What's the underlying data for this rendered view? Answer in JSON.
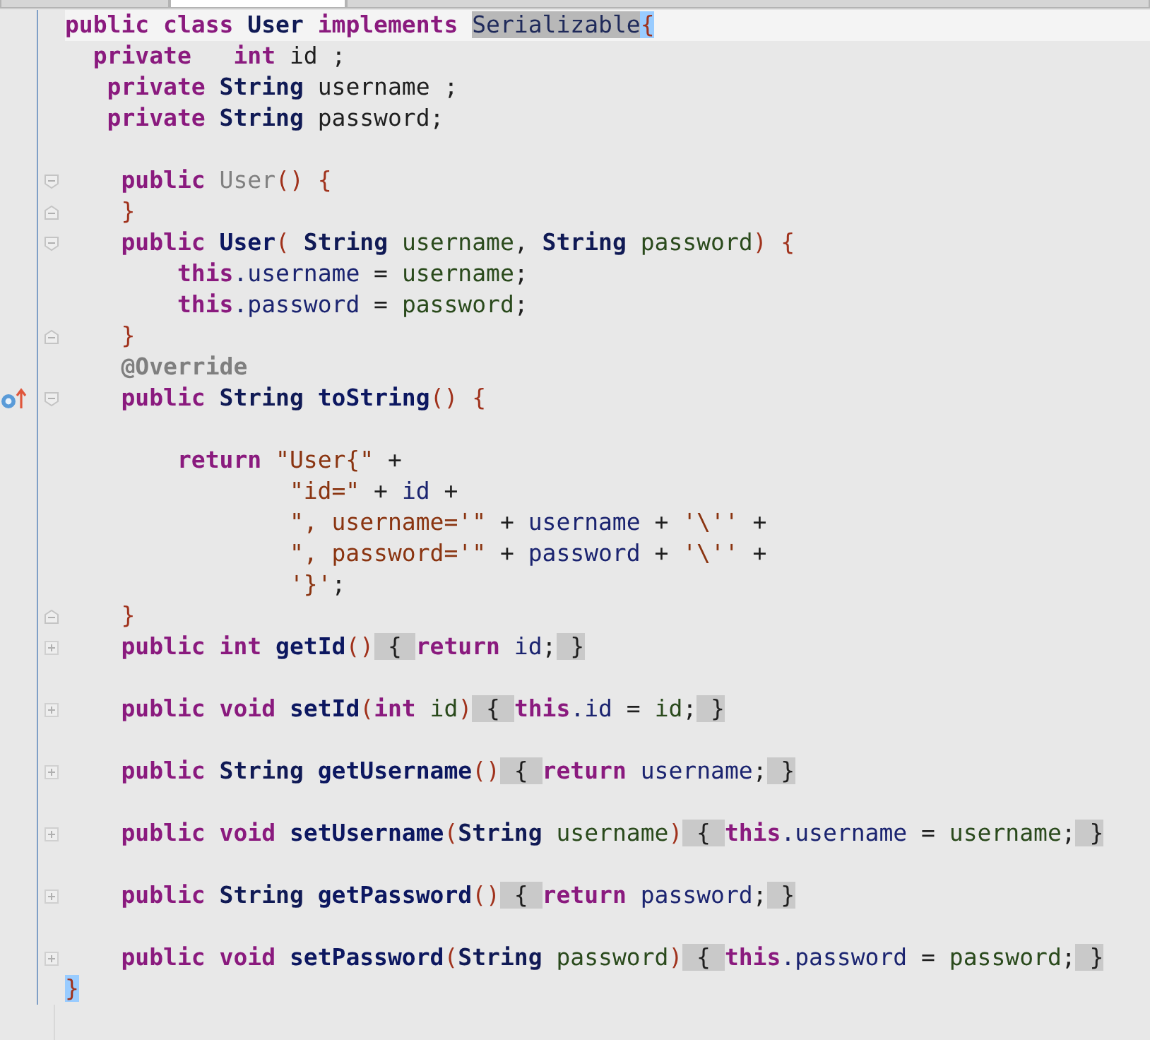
{
  "tabs": [
    {
      "selected": false
    },
    {
      "selected": true
    },
    {
      "selected": false
    }
  ],
  "lines": [
    {
      "current": true,
      "tokens": [
        {
          "kind": "kw",
          "text": "public class "
        },
        {
          "kind": "type",
          "text": "User"
        },
        {
          "kind": "kw",
          "text": " implements "
        },
        {
          "kind": "hl",
          "text": "Serializable"
        },
        {
          "kind": "match",
          "text": "{"
        }
      ]
    },
    {
      "current": false,
      "tokens": [
        {
          "kind": "kw",
          "text": "  private   int"
        },
        {
          "kind": "plain",
          "text": " id ;"
        }
      ]
    },
    {
      "current": false,
      "tokens": [
        {
          "kind": "kw",
          "text": "   private "
        },
        {
          "kind": "type",
          "text": "String"
        },
        {
          "kind": "plain",
          "text": " username ;"
        }
      ]
    },
    {
      "current": false,
      "tokens": [
        {
          "kind": "kw",
          "text": "   private "
        },
        {
          "kind": "type",
          "text": "String"
        },
        {
          "kind": "plain",
          "text": " password;"
        }
      ]
    },
    {
      "current": false
    },
    {
      "current": false,
      "fold": {
        "kind": "open"
      },
      "tokens": [
        {
          "kind": "kw",
          "text": "    public "
        },
        {
          "kind": "unused",
          "text": "User"
        },
        {
          "kind": "punc",
          "text": "() {"
        }
      ]
    },
    {
      "current": false,
      "fold": {
        "kind": "close"
      },
      "tokens": [
        {
          "kind": "punc",
          "text": "    }"
        }
      ]
    },
    {
      "current": false,
      "fold": {
        "kind": "open"
      },
      "tokens": [
        {
          "kind": "kw",
          "text": "    public "
        },
        {
          "kind": "method",
          "text": "User"
        },
        {
          "kind": "punc",
          "text": "( "
        },
        {
          "kind": "type",
          "text": "String"
        },
        {
          "kind": "param",
          "text": " username"
        },
        {
          "kind": "plain",
          "text": ", "
        },
        {
          "kind": "type",
          "text": "String"
        },
        {
          "kind": "param",
          "text": " password"
        },
        {
          "kind": "punc",
          "text": ") {"
        }
      ]
    },
    {
      "current": false,
      "tokens": [
        {
          "kind": "kw",
          "text": "        this"
        },
        {
          "kind": "field",
          "text": ".username"
        },
        {
          "kind": "plain",
          "text": " = "
        },
        {
          "kind": "param",
          "text": "username"
        },
        {
          "kind": "plain",
          "text": ";"
        }
      ]
    },
    {
      "current": false,
      "tokens": [
        {
          "kind": "kw",
          "text": "        this"
        },
        {
          "kind": "field",
          "text": ".password"
        },
        {
          "kind": "plain",
          "text": " = "
        },
        {
          "kind": "param",
          "text": "password"
        },
        {
          "kind": "plain",
          "text": ";"
        }
      ]
    },
    {
      "current": false,
      "fold": {
        "kind": "close"
      },
      "tokens": [
        {
          "kind": "punc",
          "text": "    }"
        }
      ]
    },
    {
      "current": false,
      "tokens": [
        {
          "kind": "ann",
          "text": "    @Override"
        }
      ]
    },
    {
      "current": false,
      "fold": {
        "kind": "open"
      },
      "marker": {
        "kind": "override"
      },
      "tokens": [
        {
          "kind": "kw",
          "text": "    public "
        },
        {
          "kind": "type",
          "text": "String "
        },
        {
          "kind": "method",
          "text": "toString"
        },
        {
          "kind": "punc",
          "text": "() {"
        }
      ]
    },
    {
      "current": false
    },
    {
      "current": false,
      "tokens": [
        {
          "kind": "kw",
          "text": "        return "
        },
        {
          "kind": "str",
          "text": "\"User{\""
        },
        {
          "kind": "plain",
          "text": " +"
        }
      ]
    },
    {
      "current": false,
      "tokens": [
        {
          "kind": "str",
          "text": "                \"id=\""
        },
        {
          "kind": "plain",
          "text": " + "
        },
        {
          "kind": "field",
          "text": "id"
        },
        {
          "kind": "plain",
          "text": " +"
        }
      ]
    },
    {
      "current": false,
      "tokens": [
        {
          "kind": "str",
          "text": "                \", username='\""
        },
        {
          "kind": "plain",
          "text": " + "
        },
        {
          "kind": "field",
          "text": "username"
        },
        {
          "kind": "plain",
          "text": " + "
        },
        {
          "kind": "str",
          "text": "'\\''"
        },
        {
          "kind": "plain",
          "text": " +"
        }
      ]
    },
    {
      "current": false,
      "tokens": [
        {
          "kind": "str",
          "text": "                \", password='\""
        },
        {
          "kind": "plain",
          "text": " + "
        },
        {
          "kind": "field",
          "text": "password"
        },
        {
          "kind": "plain",
          "text": " + "
        },
        {
          "kind": "str",
          "text": "'\\''"
        },
        {
          "kind": "plain",
          "text": " +"
        }
      ]
    },
    {
      "current": false,
      "tokens": [
        {
          "kind": "str",
          "text": "                '}'"
        },
        {
          "kind": "plain",
          "text": ";"
        }
      ]
    },
    {
      "current": false,
      "fold": {
        "kind": "close"
      },
      "tokens": [
        {
          "kind": "punc",
          "text": "    }"
        }
      ]
    },
    {
      "current": false,
      "fold": {
        "kind": "collapsed"
      },
      "tokens": [
        {
          "kind": "kw",
          "text": "    public int "
        },
        {
          "kind": "method",
          "text": "getId"
        },
        {
          "kind": "punc",
          "text": "()"
        },
        {
          "kind": "fold",
          "text": " { "
        },
        {
          "kind": "kw",
          "text": "return"
        },
        {
          "kind": "field",
          "text": " id"
        },
        {
          "kind": "plain",
          "text": ";"
        },
        {
          "kind": "fold",
          "text": " }"
        }
      ]
    },
    {
      "current": false
    },
    {
      "current": false,
      "fold": {
        "kind": "collapsed"
      },
      "tokens": [
        {
          "kind": "kw",
          "text": "    public void "
        },
        {
          "kind": "method",
          "text": "setId"
        },
        {
          "kind": "punc",
          "text": "("
        },
        {
          "kind": "kw",
          "text": "int"
        },
        {
          "kind": "param",
          "text": " id"
        },
        {
          "kind": "punc",
          "text": ")"
        },
        {
          "kind": "fold",
          "text": " { "
        },
        {
          "kind": "kw",
          "text": "this"
        },
        {
          "kind": "field",
          "text": ".id"
        },
        {
          "kind": "plain",
          "text": " = "
        },
        {
          "kind": "param",
          "text": "id"
        },
        {
          "kind": "plain",
          "text": ";"
        },
        {
          "kind": "fold",
          "text": " }"
        }
      ]
    },
    {
      "current": false
    },
    {
      "current": false,
      "fold": {
        "kind": "collapsed"
      },
      "tokens": [
        {
          "kind": "kw",
          "text": "    public "
        },
        {
          "kind": "type",
          "text": "String "
        },
        {
          "kind": "method",
          "text": "getUsername"
        },
        {
          "kind": "punc",
          "text": "()"
        },
        {
          "kind": "fold",
          "text": " { "
        },
        {
          "kind": "kw",
          "text": "return"
        },
        {
          "kind": "field",
          "text": " username"
        },
        {
          "kind": "plain",
          "text": ";"
        },
        {
          "kind": "fold",
          "text": " }"
        }
      ]
    },
    {
      "current": false
    },
    {
      "current": false,
      "fold": {
        "kind": "collapsed"
      },
      "tokens": [
        {
          "kind": "kw",
          "text": "    public void "
        },
        {
          "kind": "method",
          "text": "setUsername"
        },
        {
          "kind": "punc",
          "text": "("
        },
        {
          "kind": "type",
          "text": "String"
        },
        {
          "kind": "param",
          "text": " username"
        },
        {
          "kind": "punc",
          "text": ")"
        },
        {
          "kind": "fold",
          "text": " { "
        },
        {
          "kind": "kw",
          "text": "this"
        },
        {
          "kind": "field",
          "text": ".username"
        },
        {
          "kind": "plain",
          "text": " = "
        },
        {
          "kind": "param",
          "text": "username"
        },
        {
          "kind": "plain",
          "text": ";"
        },
        {
          "kind": "fold",
          "text": " }"
        }
      ]
    },
    {
      "current": false
    },
    {
      "current": false,
      "fold": {
        "kind": "collapsed"
      },
      "tokens": [
        {
          "kind": "kw",
          "text": "    public "
        },
        {
          "kind": "type",
          "text": "String "
        },
        {
          "kind": "method",
          "text": "getPassword"
        },
        {
          "kind": "punc",
          "text": "()"
        },
        {
          "kind": "fold",
          "text": " { "
        },
        {
          "kind": "kw",
          "text": "return"
        },
        {
          "kind": "field",
          "text": " password"
        },
        {
          "kind": "plain",
          "text": ";"
        },
        {
          "kind": "fold",
          "text": " }"
        }
      ]
    },
    {
      "current": false
    },
    {
      "current": false,
      "fold": {
        "kind": "collapsed"
      },
      "tokens": [
        {
          "kind": "kw",
          "text": "    public void "
        },
        {
          "kind": "method",
          "text": "setPassword"
        },
        {
          "kind": "punc",
          "text": "("
        },
        {
          "kind": "type",
          "text": "String"
        },
        {
          "kind": "param",
          "text": " password"
        },
        {
          "kind": "punc",
          "text": ")"
        },
        {
          "kind": "fold",
          "text": " { "
        },
        {
          "kind": "kw",
          "text": "this"
        },
        {
          "kind": "field",
          "text": ".password"
        },
        {
          "kind": "plain",
          "text": " = "
        },
        {
          "kind": "param",
          "text": "password"
        },
        {
          "kind": "plain",
          "text": ";"
        },
        {
          "kind": "fold",
          "text": " }"
        }
      ]
    },
    {
      "current": false,
      "tokens": [
        {
          "kind": "match",
          "text": "}"
        }
      ]
    }
  ]
}
